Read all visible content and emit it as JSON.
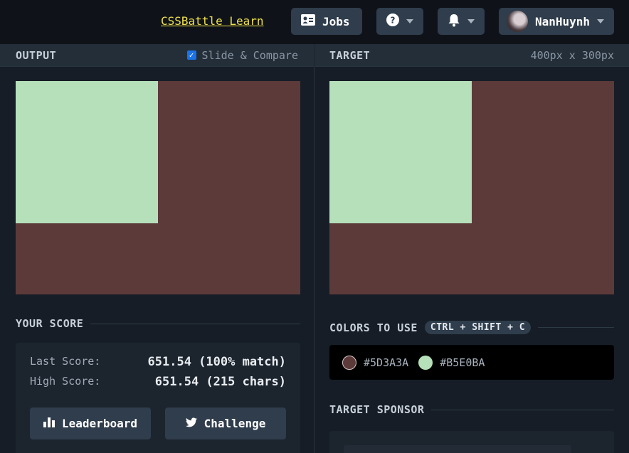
{
  "topbar": {
    "learn_link": "CSSBattle Learn",
    "jobs_label": "Jobs",
    "username": "NanHuynh"
  },
  "output": {
    "title": "OUTPUT",
    "slide_compare_label": "Slide & Compare",
    "slide_compare_checked": true
  },
  "target": {
    "title": "TARGET",
    "size_label": "400px x 300px"
  },
  "canvas_colors": {
    "background": "#5D3A3A",
    "square": "#B5E0BA"
  },
  "score": {
    "section_title": "YOUR SCORE",
    "last_label": "Last Score:",
    "last_value": "651.54 (100% match)",
    "high_label": "High Score:",
    "high_value": "651.54 (215 chars)",
    "leaderboard_label": "Leaderboard",
    "challenge_label": "Challenge"
  },
  "colors": {
    "section_title": "COLORS TO USE",
    "shortcut": "CTRL + SHIFT + C",
    "items": [
      {
        "hex": "#5D3A3A",
        "swatch": "#5D3A3A"
      },
      {
        "hex": "#B5E0BA",
        "swatch": "#B5E0BA"
      }
    ]
  },
  "sponsor": {
    "section_title": "TARGET SPONSOR"
  },
  "icons": [
    "id-card-icon",
    "help-icon",
    "bell-icon",
    "chevron-down-icon",
    "bar-chart-icon",
    "twitter-icon",
    "checkbox-icon"
  ]
}
